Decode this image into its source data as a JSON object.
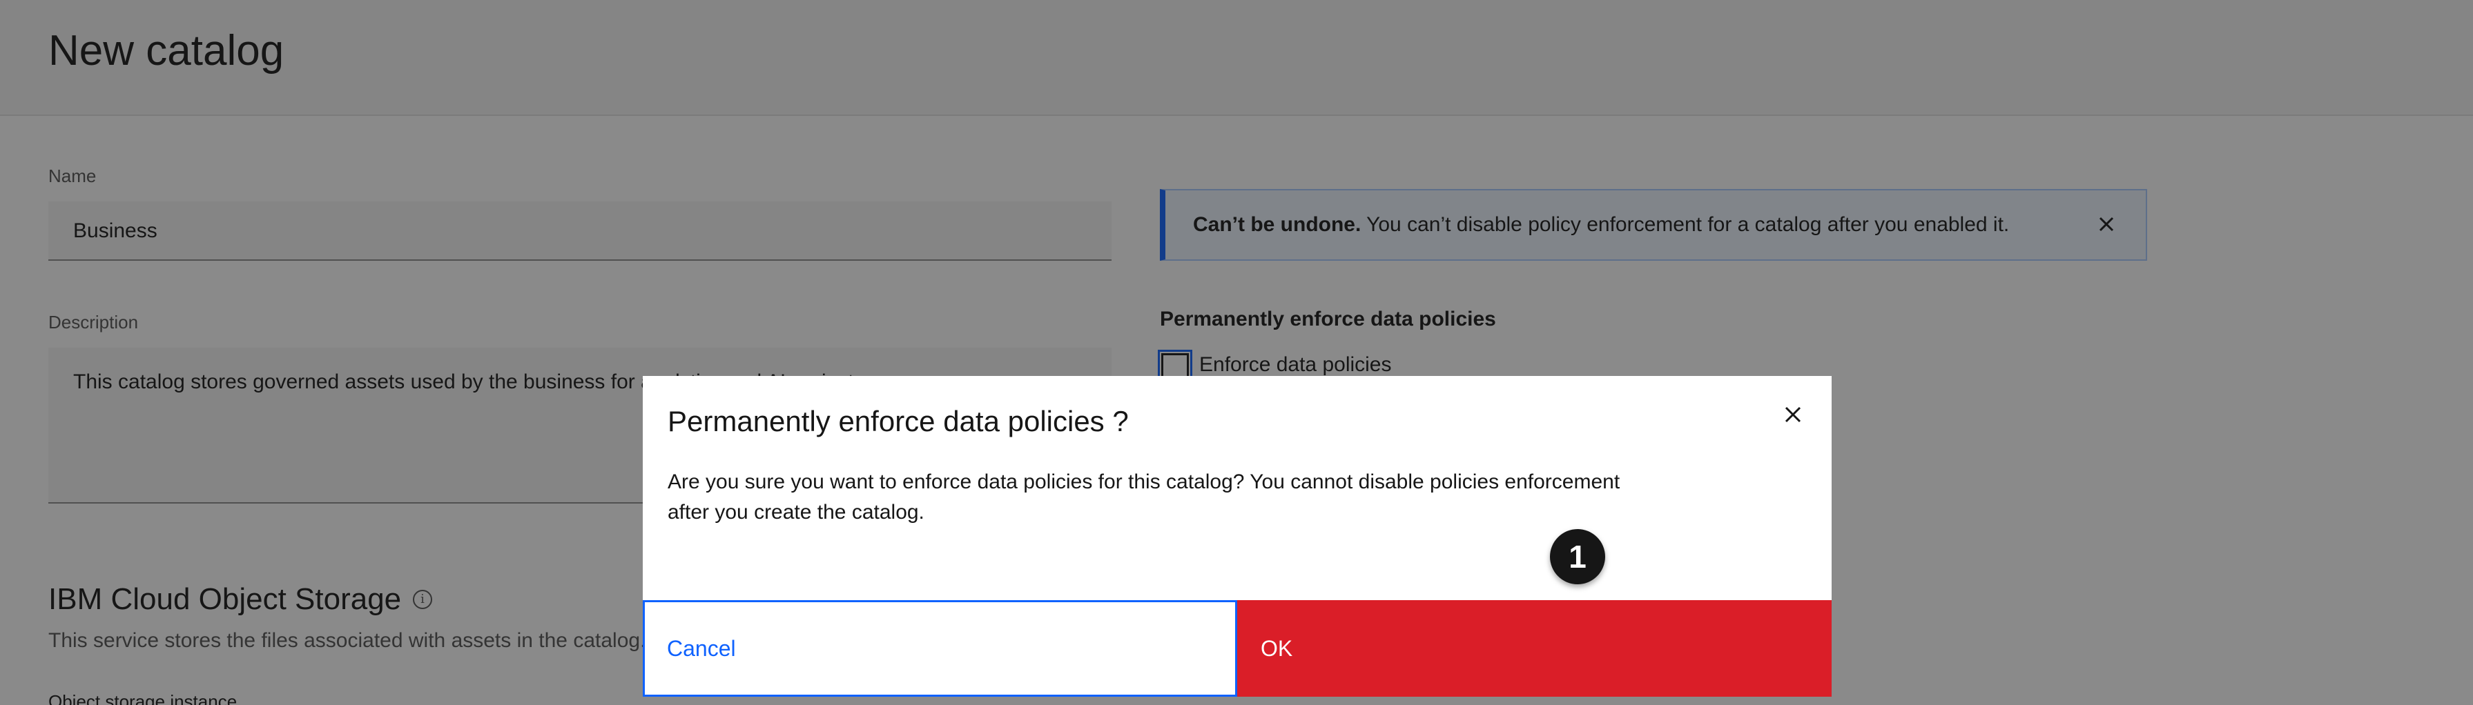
{
  "header": {
    "title": "New catalog"
  },
  "form": {
    "name_label": "Name",
    "name_value": "Business",
    "description_label": "Description",
    "description_value": "This catalog stores governed assets used by the business for analytics and AI projects."
  },
  "storage": {
    "title": "IBM Cloud Object Storage",
    "subtitle": "This service stores the files associated with assets in the catalog.",
    "instance_label": "Object storage instance",
    "info_icon": "info-icon"
  },
  "notice": {
    "strong": "Can’t be undone.",
    "text": " You can’t disable policy enforcement for a catalog after you enabled it.",
    "close_icon": "close-icon"
  },
  "policies": {
    "heading": "Permanently enforce data policies",
    "checkbox_label": "Enforce data policies",
    "checked": false
  },
  "modal": {
    "title": "Permanently enforce data policies ?",
    "body": "Are you sure you want to enforce data policies for this catalog? You cannot disable policies enforcement after you create the catalog.",
    "cancel_label": "Cancel",
    "ok_label": "OK",
    "step_badge": "1"
  },
  "colors": {
    "primary": "#0f62fe",
    "danger": "#da1e28",
    "overlay": "rgba(22,22,22,0.5)"
  }
}
